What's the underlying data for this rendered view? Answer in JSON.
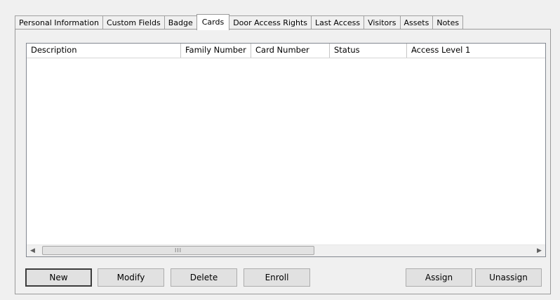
{
  "tabs": [
    {
      "label": "Personal Information"
    },
    {
      "label": "Custom Fields"
    },
    {
      "label": "Badge"
    },
    {
      "label": "Cards",
      "active": true
    },
    {
      "label": "Door Access Rights"
    },
    {
      "label": "Last Access"
    },
    {
      "label": "Visitors"
    },
    {
      "label": "Assets"
    },
    {
      "label": "Notes"
    }
  ],
  "list": {
    "columns": [
      "Description",
      "Family Number",
      "Card Number",
      "Status",
      "Access Level 1"
    ],
    "rows": [],
    "scroll_left_icon": "scroll-left-arrow-icon",
    "scroll_right_icon": "scroll-right-arrow-icon",
    "scroll_left_glyph": "◀",
    "scroll_right_glyph": "▶",
    "thumb_grip": "III"
  },
  "buttons": {
    "new": "New",
    "modify": "Modify",
    "delete": "Delete",
    "enroll": "Enroll",
    "assign": "Assign",
    "unassign": "Unassign"
  }
}
